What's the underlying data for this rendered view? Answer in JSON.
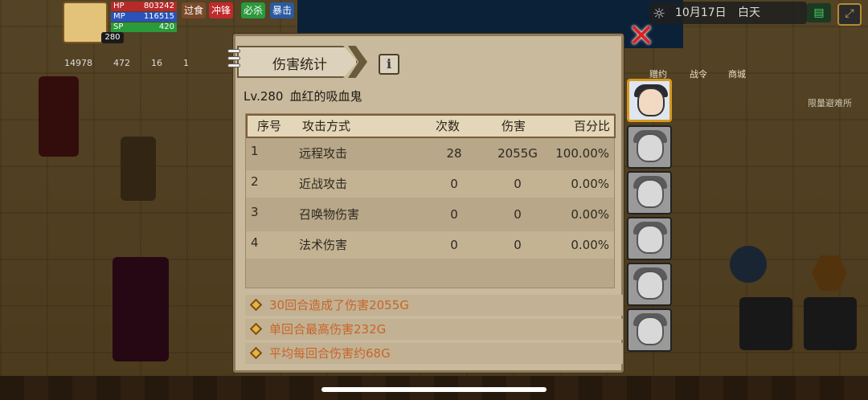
{
  "hud": {
    "level": "280",
    "stats": [
      {
        "label": "HP",
        "value": "803242"
      },
      {
        "label": "MP",
        "value": "116515"
      },
      {
        "label": "SP",
        "value": "420"
      }
    ],
    "tags": [
      "过食",
      "冲锋",
      "必杀",
      "暴击"
    ],
    "resources": [
      "14978",
      "472",
      "16",
      "1"
    ]
  },
  "top_right": {
    "date": "10月17日",
    "weather": "白天",
    "menu_labels": [
      "赠约",
      "战令",
      "商城"
    ],
    "side_label": "限量避难所"
  },
  "dialog": {
    "title": "伤害统计",
    "monster_level": "Lv.280",
    "monster_name": "血红的吸血鬼",
    "table": {
      "headers": [
        "序号",
        "攻击方式",
        "次数",
        "伤害",
        "百分比"
      ],
      "rows": [
        {
          "index": "1",
          "type": "远程攻击",
          "count": "28",
          "damage": "2055G",
          "percent": "100.00%"
        },
        {
          "index": "2",
          "type": "近战攻击",
          "count": "0",
          "damage": "0",
          "percent": "0.00%"
        },
        {
          "index": "3",
          "type": "召唤物伤害",
          "count": "0",
          "damage": "0",
          "percent": "0.00%"
        },
        {
          "index": "4",
          "type": "法术伤害",
          "count": "0",
          "damage": "0",
          "percent": "0.00%"
        }
      ]
    },
    "summary": [
      "30回合造成了伤害2055G",
      "单回合最高伤害232G",
      "平均每回合伤害约68G"
    ],
    "close_icon": "close-icon",
    "info_icon": "info-icon"
  },
  "colors": {
    "summary_text": "#c8642a",
    "active_tab_border": "#d69a1e",
    "close": "#e02020"
  }
}
